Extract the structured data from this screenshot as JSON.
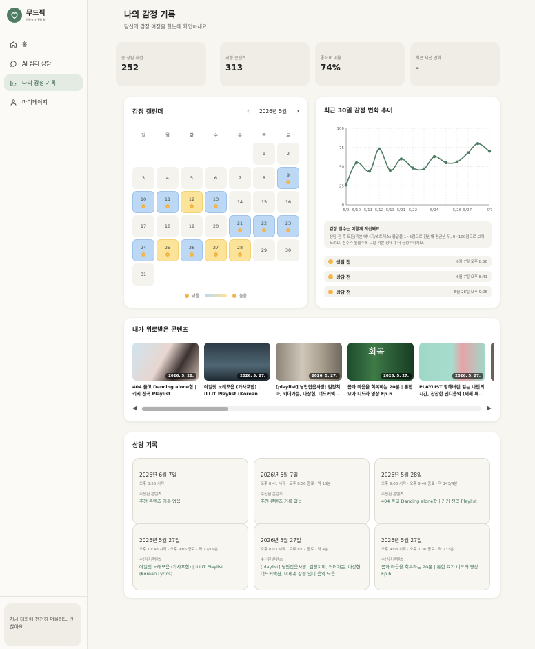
{
  "brand": {
    "name": "무드픽",
    "sub": "MoodPick"
  },
  "nav": [
    {
      "label": "홈",
      "icon": "home-icon"
    },
    {
      "label": "AI 심리 상담",
      "icon": "chat-icon"
    },
    {
      "label": "나의 감정 기록",
      "icon": "chart-icon",
      "active": true
    },
    {
      "label": "마이페이지",
      "icon": "user-icon"
    }
  ],
  "side_note": "지금 대화에 천천히 머물러도 괜찮아요.",
  "page": {
    "title": "나의 감정 기록",
    "subtitle": "당신의 감정 여정을 한눈에 확인하세요"
  },
  "stats": [
    {
      "label": "총 상담 세션",
      "value": "252"
    },
    {
      "label": "시청 콘텐츠",
      "value": "313"
    },
    {
      "label": "좋아요 비율",
      "value": "74%"
    },
    {
      "label": "최근 세션 변화",
      "value": "-"
    }
  ],
  "calendar": {
    "title": "감정 캘린더",
    "month": "2026년 5월",
    "prev": "‹",
    "next": "›",
    "dow": [
      "일",
      "월",
      "화",
      "수",
      "목",
      "금",
      "토"
    ],
    "legend_low": "낮음",
    "legend_high": "높음"
  },
  "trend": {
    "title": "최근 30일 감정 변화 추이",
    "info_title": "감정 점수는 이렇게 계산돼요",
    "info_desc": "상담 전·후 모든(기분/에너지/스트레스) 응답을 1~5점으로 환산해 평균낸 뒤, 0~100점으로 보여드려요. 점수가 높을수록 그날 기분 상태가 더 긍정적이에요.",
    "sessions": [
      {
        "label": "상담 전",
        "time": "6월 7일 오후 8:56"
      },
      {
        "label": "상담 전",
        "time": "6월 7일 오후 8:41"
      },
      {
        "label": "상담 전",
        "time": "5월 28일 오후 9:06"
      }
    ]
  },
  "chart_data": {
    "type": "line",
    "x": [
      "5/9",
      "5/10",
      "5/11",
      "5/12",
      "5/13",
      "5/21",
      "5/22",
      "5/23",
      "5/24",
      "5/25",
      "5/26",
      "5/27",
      "5/28",
      "6/7"
    ],
    "y": [
      26,
      55,
      44,
      73,
      45,
      60,
      48,
      47,
      63,
      55,
      56,
      68,
      80,
      70
    ],
    "ylim": [
      0,
      100
    ],
    "yticks": [
      0,
      25,
      50,
      75,
      100
    ],
    "xtick_labels": [
      "5/9",
      "5/10",
      "5/11",
      "5/12",
      "5/13",
      "5/21",
      "5/22",
      "5/24",
      "5/26",
      "5/27",
      "6/7"
    ],
    "grid": true,
    "color": "#4f7d63"
  },
  "contents": {
    "title": "내가 위로받은 콘텐츠",
    "items": [
      {
        "title": "404 듣고 Dancing alone함 | 키키 전곡 Playlist",
        "date": "2026. 5. 28."
      },
      {
        "title": "아일릿 노래모음 (가사포함) | ILLIT Playlist (Korean Lyrics)",
        "date": "2026. 5. 27."
      },
      {
        "title": "[playlist] 낭만잡음사랑| 검정치마, 카더가든, 나상현, 너드커넥...",
        "date": "2026. 5. 27."
      },
      {
        "title": "몸과 마음을 회복하는 20분 | 통합 요가 니드라 영상 Ep.6",
        "date": "2026. 5. 27.",
        "overlay": "회복"
      },
      {
        "title": "PLAYLIST 망해버린 잃는 나만의 시간, 잔잔한 인디음악 (새해 특...",
        "date": "2026. 5. 27."
      }
    ]
  },
  "counseling": {
    "title": "상담 기록",
    "label": "수신된 콘텐츠",
    "records": [
      {
        "date": "2026년 6월 7일",
        "time": "오후 8:56 시작",
        "content": "추천 콘텐츠 기록 없음"
      },
      {
        "date": "2026년 6월 7일",
        "time": "오후 8:41 시작 · 오후 8:56 종료 · 약 15분",
        "content": "추천 콘텐츠 기록 없음"
      },
      {
        "date": "2026년 5월 28일",
        "time": "오후 9:06 시작 · 오후 9:40 종료 · 약 143/4분",
        "content": "404 듣고 Dancing alone함 | 키키 전곡 Playlist"
      },
      {
        "date": "2026년 5월 27일",
        "time": "오후 11:48 시작 · 오후 9:06 종료 · 약 12/19분",
        "content": "아일릿 노래모음 (가사포함) | ILLIT Playlist (Korean Lyrics)"
      },
      {
        "date": "2026년 5월 27일",
        "time": "오후 8:03 시작 · 오후 8:07 종료 · 약 4분",
        "content": "[playlist] 낭만잡음사랑| 검정치마, 카더가든, 나상현, 너드커넥션, 이세계 감성 인디 음악 모음"
      },
      {
        "date": "2026년 5월 27일",
        "time": "오후 4:03 시작 · 오후 7:36 종료 · 약 233분",
        "content": "몸과 마음을 회복하는 20분 | 통합 요가 니드라 영상 Ep.6"
      }
    ]
  }
}
